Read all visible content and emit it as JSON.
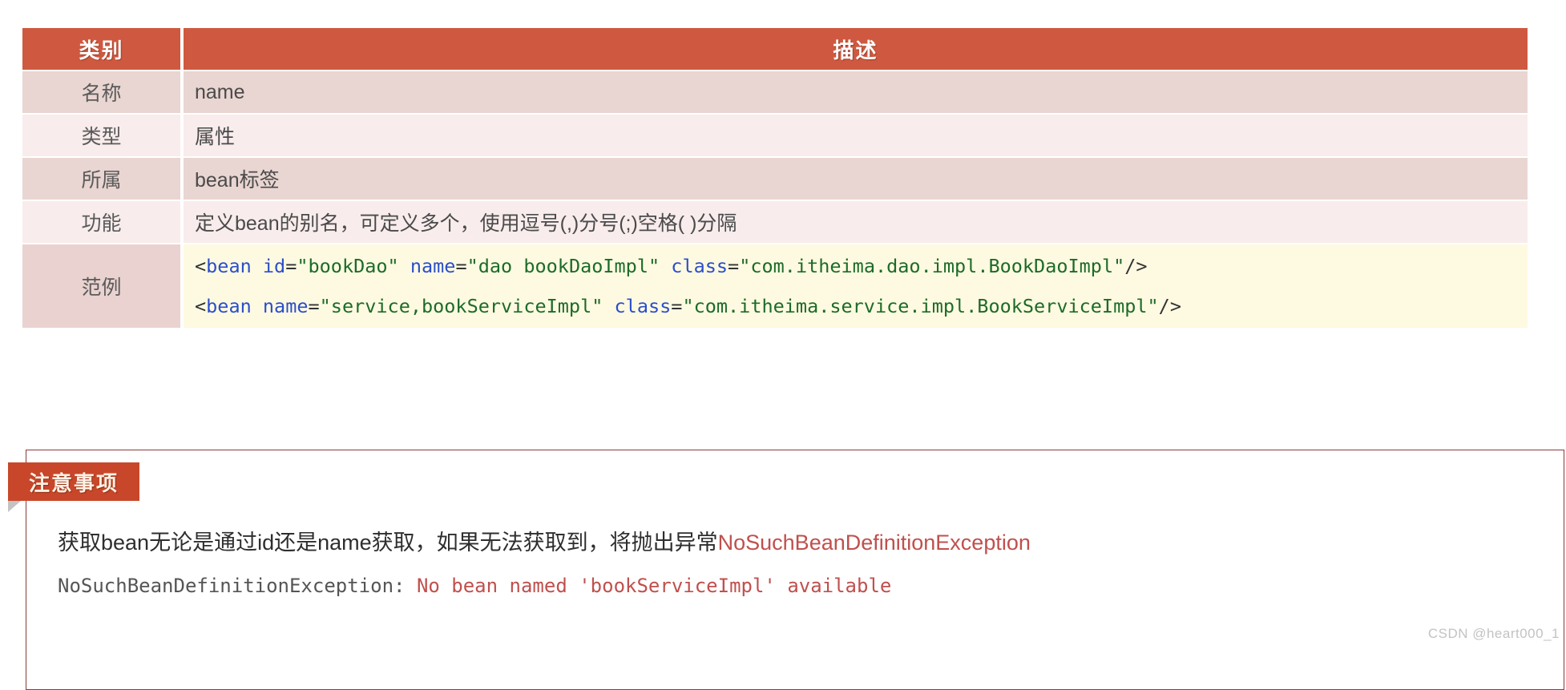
{
  "table": {
    "headers": [
      "类别",
      "描述"
    ],
    "rows": [
      {
        "label": "名称",
        "value": "name"
      },
      {
        "label": "类型",
        "value": "属性"
      },
      {
        "label": "所属",
        "value": "bean标签"
      },
      {
        "label": "功能",
        "value": "定义bean的别名，可定义多个，使用逗号(,)分号(;)空格( )分隔"
      }
    ],
    "code_row": {
      "label": "范例",
      "lines": [
        {
          "open": "<",
          "tag": "bean",
          "sp1": " ",
          "attr1": "id",
          "eq1": "=",
          "val1": "\"bookDao\"",
          "sp2": " ",
          "attr2": "name",
          "eq2": "=",
          "val2": "\"dao bookDaoImpl\"",
          "sp3": " ",
          "attr3": "class",
          "eq3": "=",
          "val3": "\"com.itheima.dao.impl.BookDaoImpl\"",
          "close": "/>",
          "full": "<bean id=\"bookDao\" name=\"dao bookDaoImpl\" class=\"com.itheima.dao.impl.BookDaoImpl\"/>"
        },
        {
          "open": "<",
          "tag": "bean",
          "sp1": " ",
          "attr1": "name",
          "eq1": "=",
          "val1": "\"service,bookServiceImpl\"",
          "sp2": " ",
          "attr2": "class",
          "eq2": "=",
          "val2": "\"com.itheima.service.impl.BookServiceImpl\"",
          "close": "/>",
          "full": "<bean name=\"service,bookServiceImpl\" class=\"com.itheima.service.impl.BookServiceImpl\"/>"
        }
      ]
    }
  },
  "note": {
    "badge_label": "注意事项",
    "line1_prefix": "获取bean无论是通过id还是name获取，如果无法获取到，将抛出异常",
    "line1_exception": "NoSuchBeanDefinitionException",
    "line2_prefix": "NoSuchBeanDefinitionException: ",
    "line2_message": "No bean named 'bookServiceImpl' available"
  },
  "watermark": "CSDN @heart000_1",
  "colors": {
    "header_bg": "#cf5940",
    "row_dark": "#e9d5d1",
    "row_light": "#f8ecec",
    "code_bg": "#fdfae1",
    "badge_bg": "#c8472a",
    "note_border": "#8a3b38",
    "tag_blue": "#2b4ecb",
    "string_green": "#1c6b29",
    "exception_red": "#c0504d"
  }
}
